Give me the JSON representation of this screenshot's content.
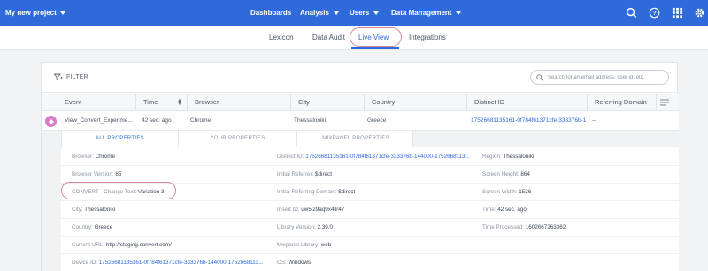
{
  "topbar": {
    "project": "My new project",
    "nav": [
      "Dashboards",
      "Analysis",
      "Users",
      "Data Management"
    ]
  },
  "subnav": {
    "tabs": [
      "Lexicon",
      "Data Audit",
      "Live View",
      "Integrations"
    ],
    "active": "Live View"
  },
  "toolbar": {
    "filter_label": "FILTER",
    "search_placeholder": "Search for an email address, user id, etc."
  },
  "table": {
    "columns": [
      "Event",
      "Time",
      "Browser",
      "City",
      "Country",
      "Distinct ID",
      "Referring Domain"
    ],
    "row": {
      "event": "View_Convert_Experime...",
      "time": "42 sec. ago",
      "browser": "Chrome",
      "city": "Thessaloniki",
      "country": "Greece",
      "distinct_id": "17526681135161-0f784f61371cfe-333376b-1...",
      "referring_domain": "--"
    }
  },
  "properties": {
    "tabs": [
      "ALL PROPERTIES",
      "YOUR PROPERTIES",
      "MIXPANEL PROPERTIES"
    ],
    "rows": [
      [
        {
          "k": "Browser:",
          "v": "Chrome"
        },
        {
          "k": "Distinct ID:",
          "v": "17526681135161-0f784f61371cfe-333376b-144000-1752668113..."
        },
        {
          "k": "Region:",
          "v": "Thessaloniki"
        }
      ],
      [
        {
          "k": "Browser Version:",
          "v": "85"
        },
        {
          "k": "Initial Referrer:",
          "v": "$direct"
        },
        {
          "k": "Screen Height:",
          "v": "864"
        }
      ],
      [
        {
          "k": "CONVERT - Change Text:",
          "v": "Variation 3"
        },
        {
          "k": "Initial Referring Domain:",
          "v": "$direct"
        },
        {
          "k": "Screen Width:",
          "v": "1536"
        }
      ],
      [
        {
          "k": "City:",
          "v": "Thessaloniki"
        },
        {
          "k": "Insert ID:",
          "v": "uw5l29aq9x4llr47"
        },
        {
          "k": "Time:",
          "v": "42 sec. ago"
        }
      ],
      [
        {
          "k": "Country:",
          "v": "Greece"
        },
        {
          "k": "Library Version:",
          "v": "2.39.0"
        },
        {
          "k": "Time Processed:",
          "v": "1602667263362"
        }
      ],
      [
        {
          "k": "Current URL:",
          "v": "http://staging.convert.com/"
        },
        {
          "k": "Mixpanel Library:",
          "v": "web"
        },
        {
          "k": "",
          "v": ""
        }
      ],
      [
        {
          "k": "Device ID:",
          "v": "17526681135161-0f784f61371cfe-333376b-144000-1752668113..."
        },
        {
          "k": "OS:",
          "v": "Windows"
        },
        {
          "k": "",
          "v": ""
        }
      ]
    ]
  },
  "colors": {
    "brand": "#2e6ad9",
    "annotation": "#d48898"
  },
  "icons": [
    "search-icon",
    "help-icon",
    "apps-grid-icon",
    "settings-icon",
    "filter-icon",
    "sort-icon",
    "columns-icon",
    "event-icon"
  ]
}
